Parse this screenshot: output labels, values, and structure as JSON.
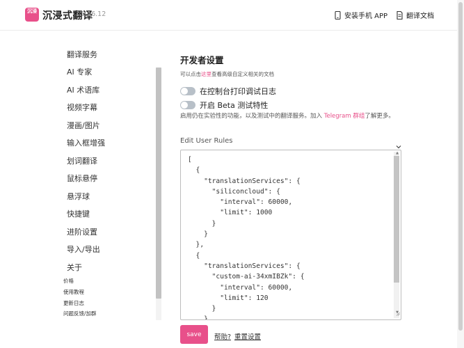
{
  "header": {
    "app_name": "沉浸式翻译",
    "version": "1.16.12",
    "logo_text": "沉浸",
    "install_app": "安装手机 APP",
    "docs": "翻译文档"
  },
  "sidebar": {
    "items": [
      {
        "label": "翻译服务"
      },
      {
        "label": "AI 专家"
      },
      {
        "label": "AI 术语库"
      },
      {
        "label": "视频字幕"
      },
      {
        "label": "漫画/图片"
      },
      {
        "label": "输入框增强"
      },
      {
        "label": "划词翻译"
      },
      {
        "label": "鼠标悬停"
      },
      {
        "label": "悬浮球"
      },
      {
        "label": "快捷键"
      },
      {
        "label": "进阶设置"
      },
      {
        "label": "导入/导出"
      },
      {
        "label": "关于"
      }
    ],
    "small_links": [
      {
        "label": "价格"
      },
      {
        "label": "使用教程"
      },
      {
        "label": "更新日志"
      },
      {
        "label": "问题反馈/加群"
      }
    ]
  },
  "main": {
    "title": "开发者设置",
    "desc_prefix": "可以点击",
    "desc_link": "这里",
    "desc_suffix": "查看高级自定义相关的文档",
    "toggles": [
      {
        "label": "在控制台打印调试日志",
        "enabled": false
      },
      {
        "label": "开启 Beta 测试特性",
        "enabled": false
      }
    ],
    "beta_note_prefix": "启用仍在实验性的功能，以及测试中的翻译服务。加入 ",
    "beta_note_link": "Telegram 群组",
    "beta_note_suffix": "了解更多。",
    "rules_label": "Edit User Rules",
    "rules_code": "[\n  {\n    \"translationServices\": {\n      \"siliconcloud\": {\n        \"interval\": 60000,\n        \"limit\": 1000\n      }\n    }\n  },\n  {\n    \"translationServices\": {\n      \"custom-ai-34xmIBZk\": {\n        \"interval\": 60000,\n        \"limit\": 120\n      }\n    }",
    "save_label": "save",
    "help_label": "帮助?",
    "reset_label": "重置设置"
  },
  "colors": {
    "accent": "#e8508a"
  }
}
